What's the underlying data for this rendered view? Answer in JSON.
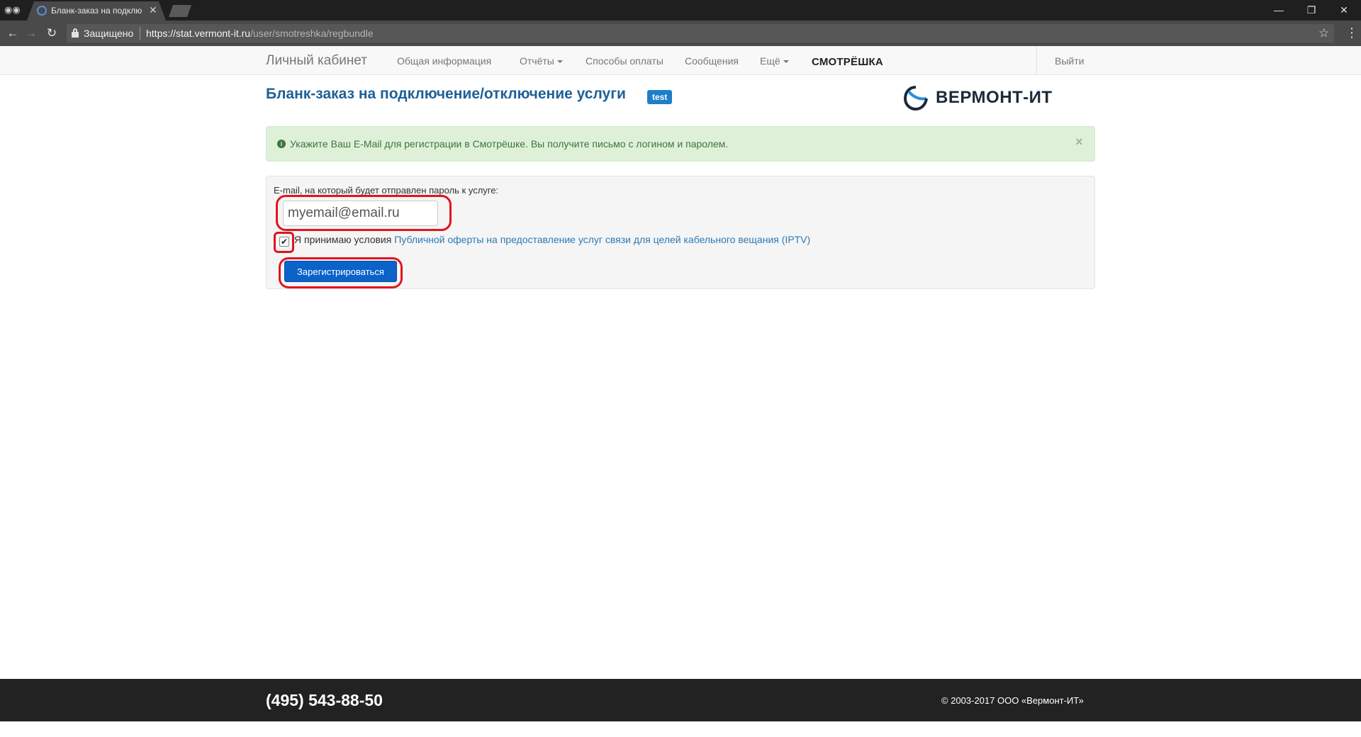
{
  "browser": {
    "tab_title": "Бланк-заказ на подклю",
    "security_label": "Защищено",
    "url_host": "https://stat.vermont-it.ru",
    "url_path": "/user/smotreshka/regbundle"
  },
  "navbar": {
    "brand": "Личный кабинет",
    "items": [
      "Общая информация",
      "Отчёты",
      "Способы оплаты",
      "Сообщения",
      "Ещё"
    ],
    "partner_logo": "СМОТРЁШКА",
    "logout": "Выйти"
  },
  "page": {
    "title": "Бланк-заказ на подключение/отключение услуги",
    "badge": "test",
    "company_logo": "ВЕРМОНТ-ИТ"
  },
  "alert": {
    "text": "Укажите Ваш E-Mail для регистрации в Смотрёшке. Вы получите письмо с логином и паролем.",
    "close": "×"
  },
  "form": {
    "email_label": "E-mail, на который будет отправлен пароль к услуге:",
    "email_value": "myemail@email.ru",
    "terms_prefix": "Я принимаю условия ",
    "terms_link": "Публичной оферты на предоставление услуг связи для целей кабельного вещания (IPTV)",
    "terms_checked": true,
    "submit_label": "Зарегистрироваться"
  },
  "footer": {
    "phone": "(495) 543-88-50",
    "copyright": "© 2003-2017 ООО «Вермонт-ИТ»"
  },
  "colors": {
    "title": "#1f5f96",
    "alert_bg": "#dff0d8",
    "alert_text": "#3c763d",
    "button": "#0b62c9",
    "highlight": "#e0141e",
    "footer_bg": "#222222"
  }
}
